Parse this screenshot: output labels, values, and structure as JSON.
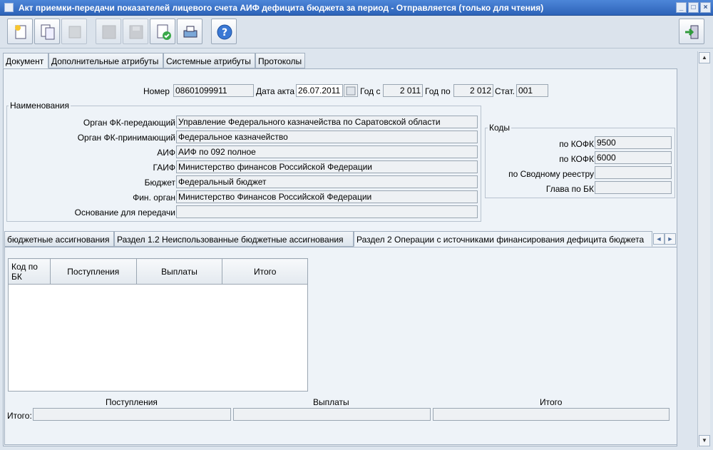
{
  "window": {
    "title": "Акт приемки-передачи показателей лицевого счета АИФ дефицита бюджета за период - Отправляется (только для чтения)"
  },
  "tabs": [
    "Документ",
    "Дополнительные атрибуты",
    "Системные атрибуты",
    "Протоколы"
  ],
  "header": {
    "number_label": "Номер",
    "number_value": "08601099911",
    "date_label": "Дата акта",
    "date_value": "26.07.2011",
    "year_from_label": "Год с",
    "year_from_value": "2 011",
    "year_to_label": "Год по",
    "year_to_value": "2 012",
    "stat_label": "Стат.",
    "stat_value": "001"
  },
  "names": {
    "title": "Наименования",
    "rows": [
      {
        "label": "Орган ФК-передающий",
        "value": "Управление Федерального казначейства по Саратовской области"
      },
      {
        "label": "Орган ФК-принимающий",
        "value": "Федеральное казначейство"
      },
      {
        "label": "АИФ",
        "value": "АИФ по 092 полное"
      },
      {
        "label": "ГАИФ",
        "value": "Министерство финансов Российской Федерации"
      },
      {
        "label": "Бюджет",
        "value": "Федеральный бюджет"
      },
      {
        "label": "Фин. орган",
        "value": "Министерство Финансов Российской Федерации"
      },
      {
        "label": "Основание для передачи",
        "value": ""
      }
    ]
  },
  "codes": {
    "title": "Коды",
    "rows": [
      {
        "label": "по КОФК",
        "value": "9500"
      },
      {
        "label": "по КОФК",
        "value": "6000"
      },
      {
        "label": "по Сводному реестру",
        "value": ""
      },
      {
        "label": "Глава по БК",
        "value": ""
      }
    ]
  },
  "subtabs": [
    "бюджетные ассигнования",
    "Раздел 1.2 Неиспользованные бюджетные ассигнования",
    "Раздел 2 Операции с источниками финансирования дефицита бюджета"
  ],
  "grid": {
    "columns": [
      "Код по БК",
      "Поступления",
      "Выплаты",
      "Итого"
    ]
  },
  "totals": {
    "label": "Итого:",
    "columns": [
      "Поступления",
      "Выплаты",
      "Итого"
    ]
  }
}
